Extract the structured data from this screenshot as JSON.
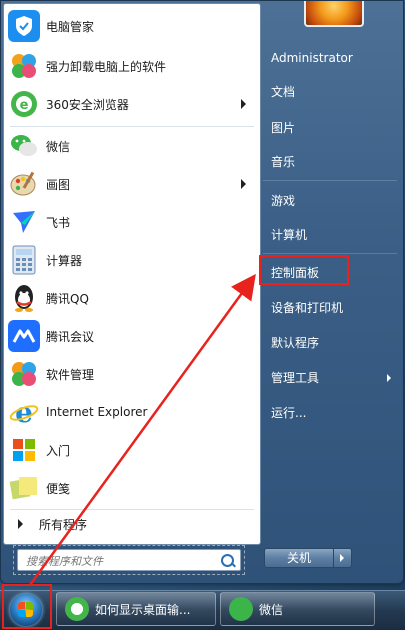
{
  "start_menu": {
    "programs": [
      {
        "label": "电脑管家",
        "icon": "tencent-pc-manager-icon",
        "color": "#1b8ef0"
      },
      {
        "label": "强力卸载电脑上的软件",
        "icon": "uninstall-icon",
        "color": "#f3a21c"
      },
      {
        "label": "360安全浏览器",
        "icon": "360-browser-icon",
        "color": "#43b649",
        "has_submenu": true
      },
      {
        "label": "微信",
        "icon": "wechat-icon",
        "color": "#3bb54a"
      },
      {
        "label": "画图",
        "icon": "paint-icon",
        "color": "#7ba7d6",
        "has_submenu": true
      },
      {
        "label": "飞书",
        "icon": "feishu-icon",
        "color": "#3370ff"
      },
      {
        "label": "计算器",
        "icon": "calculator-icon",
        "color": "#6b8fb8"
      },
      {
        "label": "腾讯QQ",
        "icon": "qq-icon",
        "color": "#222222"
      },
      {
        "label": "腾讯会议",
        "icon": "tencent-meeting-icon",
        "color": "#1e6fff"
      },
      {
        "label": "软件管理",
        "icon": "software-manager-icon",
        "color": "#f29a1a"
      },
      {
        "label": "Internet Explorer",
        "icon": "internet-explorer-icon",
        "color": "#1f8ad6"
      },
      {
        "label": "入门",
        "icon": "getting-started-icon",
        "color": "#5fa0d8"
      },
      {
        "label": "便笺",
        "icon": "sticky-notes-icon",
        "color": "#c7d86a"
      }
    ],
    "all_programs_label": "所有程序",
    "search_placeholder": "搜索程序和文件",
    "right": {
      "user_name": "Administrator",
      "items": [
        {
          "label": "文档"
        },
        {
          "label": "图片"
        },
        {
          "label": "音乐"
        },
        {
          "label": "游戏"
        },
        {
          "label": "计算机"
        },
        {
          "label": "控制面板"
        },
        {
          "label": "设备和打印机"
        },
        {
          "label": "默认程序"
        },
        {
          "label": "管理工具",
          "has_submenu": true
        },
        {
          "label": "运行..."
        }
      ]
    },
    "shutdown_label": "关机"
  },
  "taskbar": {
    "buttons": [
      {
        "label": "如何显示桌面输...",
        "icon": "360-browser-icon"
      },
      {
        "label": "微信",
        "icon": "wechat-icon"
      }
    ]
  },
  "colors": {
    "highlight": "#e8221d",
    "menu_bg": "#3b5f86"
  }
}
